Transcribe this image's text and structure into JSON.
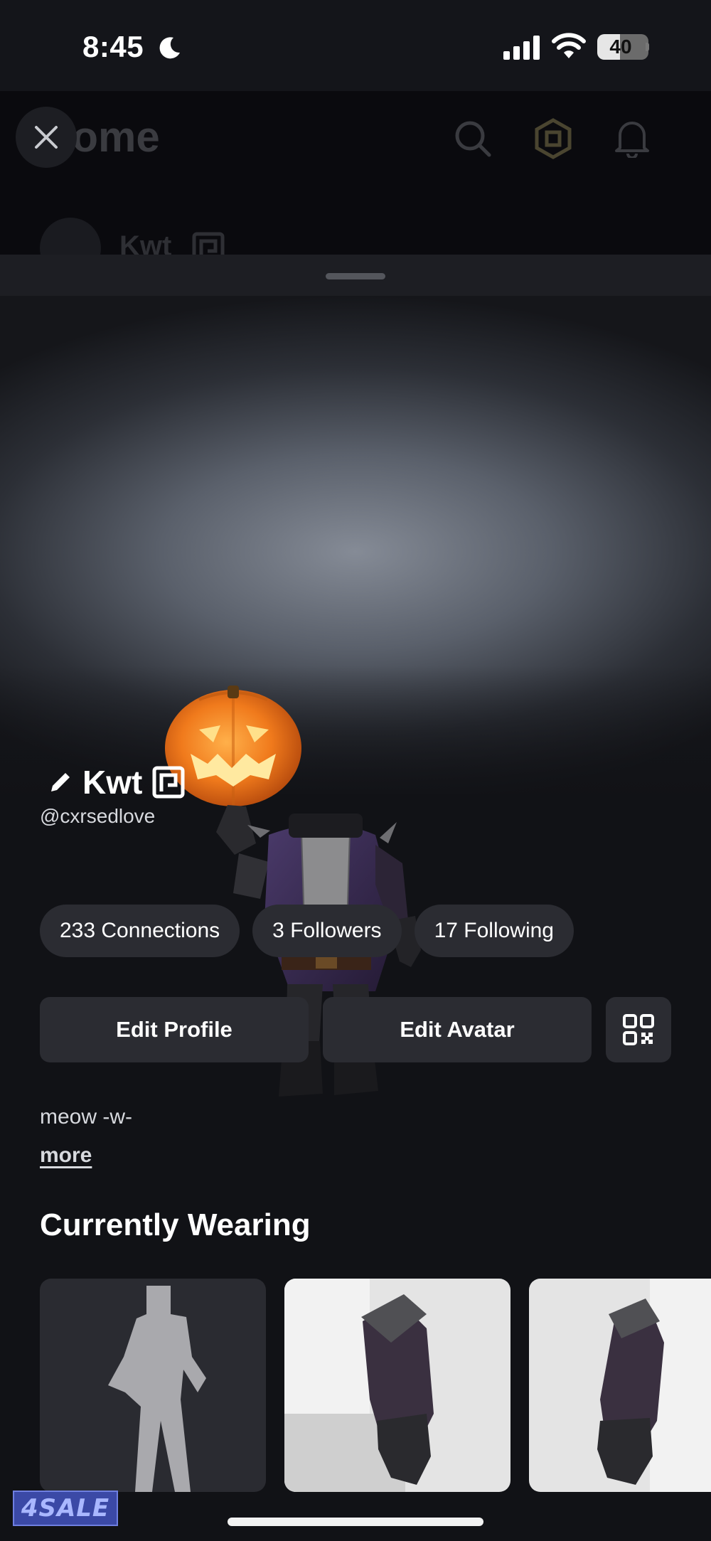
{
  "status_bar": {
    "time": "8:45",
    "battery": "40",
    "battery_fraction": 0.4,
    "icons": [
      "moon-icon",
      "cellular-signal-icon",
      "wifi-icon",
      "battery-icon"
    ]
  },
  "home_header": {
    "title": "Home",
    "icons": [
      "close-icon",
      "search-icon",
      "robux-icon",
      "bell-icon"
    ],
    "peek_name": "Kwt"
  },
  "profile": {
    "display_name": "Kwt",
    "username": "@cxrsedlove",
    "icons": [
      "pencil-icon",
      "verified-badge-icon"
    ],
    "stats": [
      {
        "label": "233 Connections"
      },
      {
        "label": "3 Followers"
      },
      {
        "label": "17 Following"
      }
    ],
    "actions": {
      "edit_profile": "Edit Profile",
      "edit_avatar": "Edit Avatar",
      "qr_icon": "qr-code-icon"
    },
    "bio": "meow -w-",
    "more": "more"
  },
  "currently_wearing": {
    "title": "Currently Wearing",
    "items": [
      {
        "icon": "body-silhouette-icon"
      },
      {
        "icon": "armored-arm-item"
      },
      {
        "icon": "armored-arm-item"
      }
    ]
  },
  "watermark": "4SALE",
  "colors": {
    "background": "#111216",
    "pill": "#2b2c32",
    "header_dim": "#0a0a0e",
    "accent_watermark": "#3b49a6"
  }
}
